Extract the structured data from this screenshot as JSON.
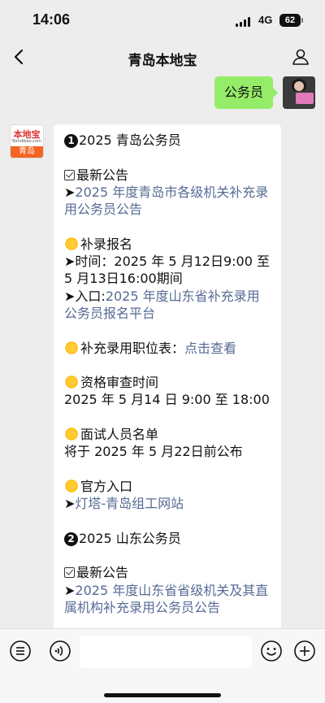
{
  "status": {
    "time": "14:06",
    "network": "4G",
    "battery": "62"
  },
  "nav": {
    "title": "青岛本地宝"
  },
  "outgoing": {
    "text": "公务员"
  },
  "bot_avatar": {
    "logo": "本地宝",
    "site": "Bendibao.com",
    "city": "青岛"
  },
  "message": {
    "s1_num": "1",
    "s1_title": "2025 青岛公务员",
    "s1_news_heading": "最新公告",
    "s1_news_link": "2025 年度青岛市各级机关补充录用公务员公告",
    "s1_reg_heading": "补录报名",
    "s1_reg_time_label": "➤时间：",
    "s1_reg_time_value": "2025 年 5 月12日9:00 至 5 月13日16:00期间",
    "s1_entry_label": "➤入口:",
    "s1_entry_link": "2025 年度山东省补充录用公务员报名平台",
    "s1_positions_label": "补充录用职位表：",
    "s1_positions_link": "点击查看",
    "s1_review_heading": "资格审查时间",
    "s1_review_value": "2025 年 5 月14 日 9:00 至 18:00",
    "s1_interview_heading": "面试人员名单",
    "s1_interview_value": "将于 2025 年 5 月22日前公布",
    "s1_official_heading": "官方入口",
    "s1_official_link": "灯塔-青岛组工网站",
    "s2_num": "2",
    "s2_title": "2025 山东公务员",
    "s2_news_heading": "最新公告",
    "s2_news_link": "2025 年度山东省省级机关及其直属机构补充录用公务员公告"
  },
  "colors": {
    "outgoing_bubble": "#95ec69",
    "link": "#576b95",
    "background": "#ededed"
  }
}
